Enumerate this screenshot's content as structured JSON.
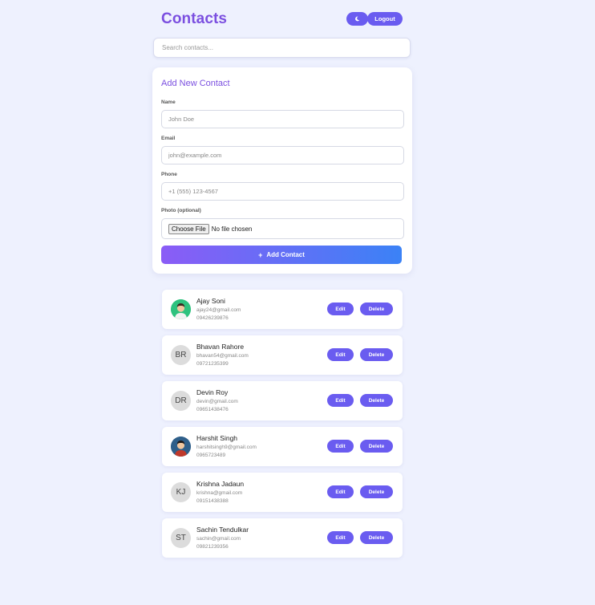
{
  "header": {
    "title": "Contacts",
    "theme_icon": "moon-icon",
    "logout_label": "Logout"
  },
  "search": {
    "placeholder": "Search contacts..."
  },
  "form": {
    "title": "Add New Contact",
    "name_label": "Name",
    "name_placeholder": "John Doe",
    "email_label": "Email",
    "email_placeholder": "john@example.com",
    "phone_label": "Phone",
    "phone_placeholder": "+1 (555) 123-4567",
    "photo_label": "Photo (optional)",
    "choose_file_label": "Choose File",
    "no_file_text": "No file chosen",
    "submit_label": "Add Contact"
  },
  "contacts": [
    {
      "name": "Ajay Soni",
      "email": "ajay24@gmail.com",
      "phone": "09426239876",
      "initials": "",
      "photo": "avatar-man-green"
    },
    {
      "name": "Bhavan Rahore",
      "email": "bhavan54@gmail.com",
      "phone": "09721235399",
      "initials": "BR",
      "photo": ""
    },
    {
      "name": "Devin Roy",
      "email": "devin@gmail.com",
      "phone": "09651438476",
      "initials": "DR",
      "photo": ""
    },
    {
      "name": "Harshit Singh",
      "email": "harshitsingh9@gmail.com",
      "phone": "0965723489",
      "initials": "",
      "photo": "avatar-man-blue"
    },
    {
      "name": "Krishna Jadaun",
      "email": "krishna@gmail.com",
      "phone": "09151438388",
      "initials": "KJ",
      "photo": ""
    },
    {
      "name": "Sachin Tendulkar",
      "email": "sachin@gmail.com",
      "phone": "09821239356",
      "initials": "ST",
      "photo": ""
    }
  ],
  "actions": {
    "edit_label": "Edit",
    "delete_label": "Delete"
  },
  "colors": {
    "accent": "#7b4fe0",
    "button": "#6a5cf0",
    "gradient_start": "#8b5cf6",
    "gradient_end": "#3b82f6",
    "background": "#eef1fe"
  }
}
